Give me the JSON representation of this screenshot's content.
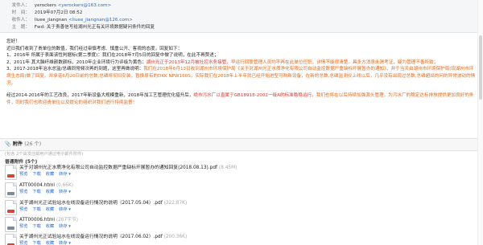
{
  "meta": {
    "sender_label": "发件人：",
    "sender_name": "yerockers",
    "sender_addr": "<yerockers@163.com>",
    "time_label": "时　间：",
    "time_value": "2019年07月2日 08:52",
    "to_label": "收件人：",
    "to_name": "liuee_jiangnan",
    "to_addr": "<liuee_jiangnan@126.com>",
    "subject_label": "主　题：",
    "subject_value": "Fwd: 关于责善信写给湖州光正有关环境数据疑问条件的回复"
  },
  "body": {
    "greeting": "您好！",
    "intro": "近日我们收到了贵单位的数值，我们经过审慎考虑、慎重公开、客观的态度，回复如下：",
    "p1_a": "1、2016年 所属于表面该性判据标(第二季度)：我们在2018年7月5日的回复中做了说明，在此不再赘述；",
    "p2_a": "2、2011年 其大脑纤维颜数颜标，2010年企业环境行为评级为黄色：",
    "p2_b": "湖州光正于2013年12月被社控水务接管，",
    "p2_c": "早运行回联管理人员均不再在此单位任职，详情不能很清楚。具多方消息未渭考证，疑为管理不善所致；",
    "p3_a": "3、2017-2018年治水总监/总磷同常频次再的到题，这里再做说明：",
    "p3_b": "我们在2018年6月13日收到湖州市环境保护局《关于对湖州光正水质净化有限公司自动监控数据严重缺标开展暂办的通知》，并于当天由湖州市环境保护局(现湖州市环境生态局)做了回复。并承诺6月20日前的总数,总磷将彻旧安装，暂换原有的DKK NPW160S，实际我们在2018年上半年就已经开始进型可购新设备，在新的总数,总磷监测仪上线以后，几乎没有出现过总数,总磷超出的问的异常波动的情况。",
    "p4_a": "经过2014-2016年的工艺改良，2017年新设备大规模重新，2018年加工艺管理优化措升后，",
    "p4_b": "绝市污水厂以直属于GB18918-2002一级A的标准稳稳运行。",
    "p4_c": "我们也将在以后持续加强源头管理，为污水厂的稳定达标排放提供更加良好的条件，同时我们也欢迎贵单位以及提论的组织对我们进行持续监督！"
  },
  "attachments": {
    "label": "附件",
    "count": "(26 个)",
    "sub": "(包含 2个由发往邮用户通过电子邮件附件)",
    "group": "普通附件 (5个)",
    "actions": {
      "preview": "预览",
      "download": "下载",
      "favorite": "收藏",
      "forward": "转存 ▾"
    },
    "items": [
      {
        "name": "关于对湖州光正水质净化有限公司自动监控数据严重缺标开展暂办的通知回复(2018.08.13).pdf",
        "size": "(8.45M)",
        "type": "pdf"
      },
      {
        "name": "ATT00004.html",
        "size": "(0.66K)",
        "type": "html"
      },
      {
        "name": "关于湖州光正试验站水在线设备运行情况的说明（2017.05.04）.pdf",
        "size": "(322.87K)",
        "type": "pdf"
      },
      {
        "name": "ATT00006.html",
        "size": "(267字节)",
        "type": "html"
      },
      {
        "name": "关于湖州光正试验站水在线设备运行情况的说明（2017.06.02）.pdf",
        "size": "(200.36K)",
        "type": "pdf"
      }
    ]
  }
}
